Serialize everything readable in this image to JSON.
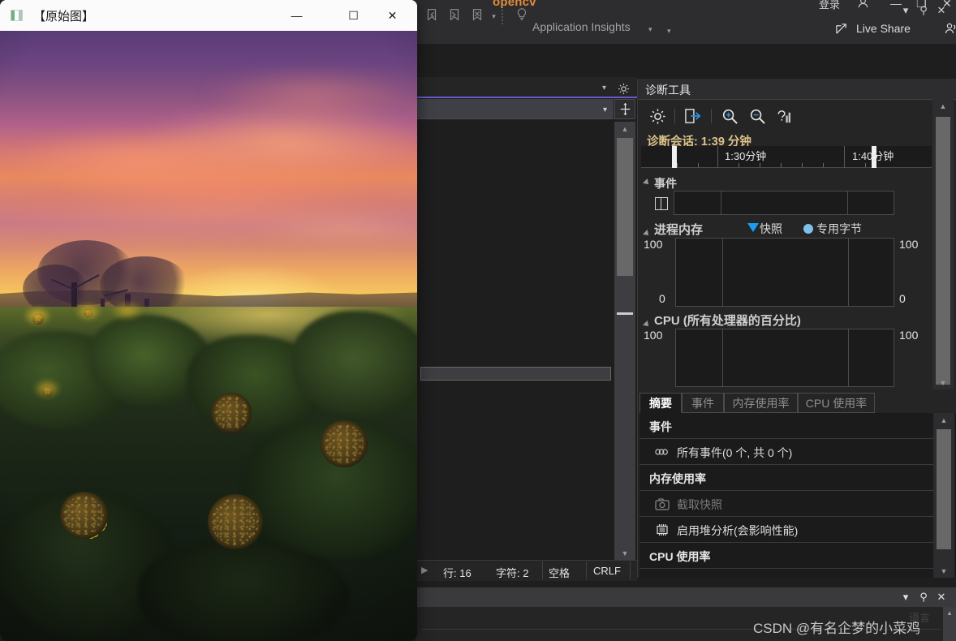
{
  "ide": {
    "title_bar": {
      "project_name": "opencv",
      "login_label": "登录",
      "account_icon": "account-icon",
      "minimize": "—",
      "maximize": "❐",
      "close": "✕"
    },
    "toolbar": {
      "bookmark_prev_icon": "bookmark-previous-icon",
      "bookmark_next_icon": "bookmark-next-icon",
      "bookmark_clear_icon": "bookmark-clear-icon",
      "overflow_caret": "▾",
      "lightbulb_icon": "lightbulb-icon",
      "app_insights_label": "Application Insights",
      "app_insights_caret": "▾",
      "toolbar_overflow": "▾",
      "live_share_label": "Live Share",
      "live_share_icon": "share-icon",
      "people_icon": "people-icon"
    },
    "editor": {
      "settings_icon": "gear-icon",
      "dropdown_caret": "▾",
      "nav_caret": "▾",
      "split_icon": "split-editor-icon",
      "scroll_up": "▲",
      "scroll_down": "▼"
    },
    "status_bar": {
      "line_label": "行: 16",
      "char_label": "字符: 2",
      "space_label": "空格",
      "eol_label": "CRLF",
      "expand_arrow": "▶"
    },
    "bottom_panel": {
      "caret": "▾",
      "pin": "⚲",
      "close": "✕",
      "watermark": "CSDN @有名企梦的小菜鸡",
      "ghost_text": "语言",
      "scroll_up": "▲"
    }
  },
  "diagnostics": {
    "panel_title": "诊断工具",
    "header_buttons": {
      "caret": "▾",
      "pin": "⚲",
      "close": "✕"
    },
    "toolbar_icons": [
      {
        "name": "settings-icon",
        "glyph": "gear"
      },
      {
        "name": "export-icon",
        "glyph": "export"
      },
      {
        "name": "zoom-in-icon",
        "glyph": "zoom-in"
      },
      {
        "name": "zoom-out-icon",
        "glyph": "zoom-out"
      },
      {
        "name": "select-chart-icon",
        "glyph": "chart-help"
      }
    ],
    "session_label": "诊断会话: 1:39 分钟",
    "timeline": {
      "labels": [
        "1:30分钟",
        "1:40分钟"
      ]
    },
    "sections": {
      "events": {
        "title": "事件",
        "icon": "events-track-icon"
      },
      "process_memory": {
        "title": "进程内存",
        "legend": [
          {
            "label": "快照",
            "marker": "triangle",
            "color": "#1d9bf0"
          },
          {
            "label": "专用字节",
            "marker": "circle",
            "color": "#7fc0e8"
          }
        ],
        "axis_max_left": "100",
        "axis_min_left": "0",
        "axis_max_right": "100",
        "axis_min_right": "0"
      },
      "cpu": {
        "title": "CPU (所有处理器的百分比)",
        "axis_max_left": "100",
        "axis_max_right": "100"
      }
    },
    "tabs": [
      {
        "label": "摘要",
        "active": true
      },
      {
        "label": "事件",
        "active": false
      },
      {
        "label": "内存使用率",
        "active": false
      },
      {
        "label": "CPU 使用率",
        "active": false
      }
    ],
    "summary": [
      {
        "type": "header",
        "label": "事件"
      },
      {
        "type": "item",
        "label": "所有事件(0 个, 共 0 个)",
        "icon": "events-icon",
        "disabled": false
      },
      {
        "type": "header",
        "label": "内存使用率"
      },
      {
        "type": "item",
        "label": "截取快照",
        "icon": "camera-icon",
        "disabled": true
      },
      {
        "type": "item",
        "label": "启用堆分析(会影响性能)",
        "icon": "memory-chip-icon",
        "disabled": false
      },
      {
        "type": "header",
        "label": "CPU 使用率"
      }
    ],
    "scroll": {
      "up": "▲",
      "down": "▼"
    }
  },
  "image_window": {
    "title": "【原始图】",
    "app_icon": "image-viewer-icon",
    "buttons": {
      "minimize": "—",
      "maximize": "☐",
      "close": "✕"
    },
    "photo_description": "日落天空下的向日葵田"
  },
  "colors": {
    "accent_purple": "#6a5acd",
    "project_orange": "#e08b3c",
    "session_gold": "#dcc389",
    "legend_blue": "#1d9bf0",
    "legend_light_blue": "#7fc0e8",
    "panel_bg": "#252526",
    "graph_bg": "#1b1b1b"
  }
}
